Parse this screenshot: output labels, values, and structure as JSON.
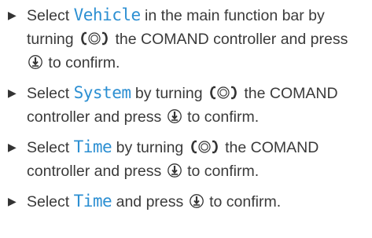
{
  "steps": [
    {
      "t1": "Select ",
      "menu": "Vehicle",
      "t2": " in the main function bar by turning ",
      "t3": " the COMAND controller and press ",
      "t4": " to confirm."
    },
    {
      "t1": "Select ",
      "menu": "System",
      "t2": " by turning ",
      "t3": " the COMAND controller and press ",
      "t4": " to confirm."
    },
    {
      "t1": "Select ",
      "menu": "Time",
      "t2": " by turning ",
      "t3": " the COMAND controller and press ",
      "t4": " to confirm."
    },
    {
      "t1": "Select ",
      "menu": "Time",
      "t2": " and press ",
      "t3": " to confirm."
    }
  ],
  "bullet": "▶",
  "icons": {
    "turn": "controller-turn-icon",
    "press": "controller-press-icon"
  },
  "colors": {
    "text": "#3a3a3a",
    "menu": "#2c8fd2"
  }
}
